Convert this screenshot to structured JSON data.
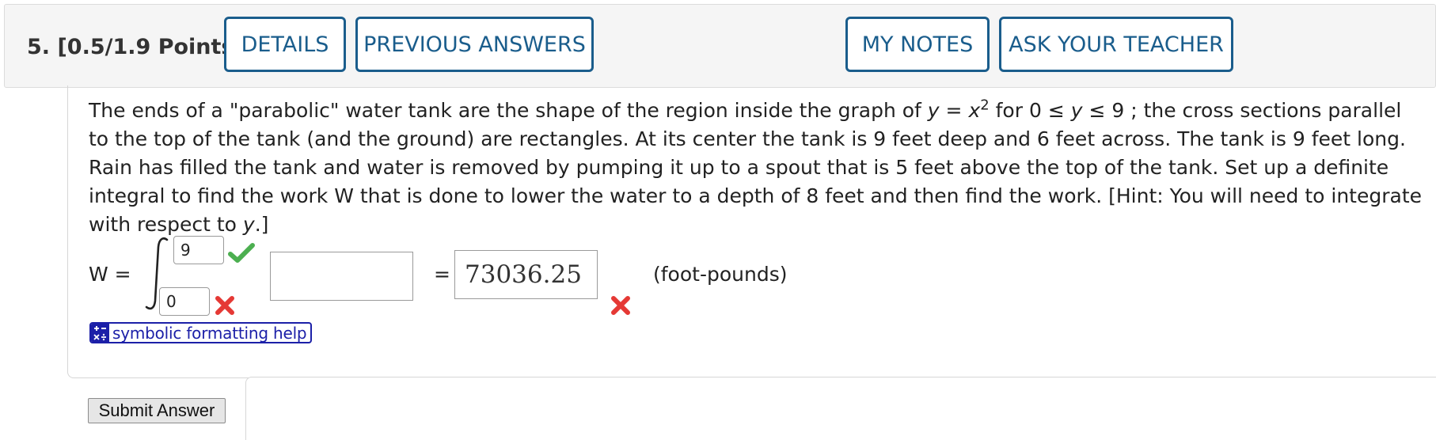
{
  "header": {
    "question_number": "5.",
    "points": "[0.5/1.9 Points]",
    "details_label": "DETAILS",
    "previous_answers_label": "PREVIOUS ANSWERS",
    "my_notes_label": "MY NOTES",
    "ask_teacher_label": "ASK YOUR TEACHER",
    "accent_color": "#1a5d8c"
  },
  "problem": {
    "part1": "The ends of a \"parabolic\" water tank are the shape of the region inside the graph of ",
    "math1_y": "y",
    "math1_eq": " = ",
    "math1_x": "x",
    "math1_exp": "2",
    "part2": " for ",
    "math2_a": "0 ≤ ",
    "math2_y": "y",
    "math2_b": " ≤ 9",
    "part3": " ; the cross sections parallel to the top of the tank (and the ground) are rectangles. At its center the tank is 9 feet deep and 6 feet across. The tank is 9 feet long. Rain has filled the tank and water is removed by pumping it up to a spout that is 5 feet above the top of the tank. Set up a definite integral to find the work W that is done to lower the water to a depth of 8 feet and then find the work. [Hint: You will need to integrate with respect to ",
    "hint_var": "y",
    "part4": ".]"
  },
  "answer_form": {
    "w_label": "W =",
    "upper_limit": "9",
    "lower_limit": "0",
    "integrand_value": "",
    "equals": "=",
    "answer_value": "73036.25",
    "units": "(foot-pounds)",
    "correct_color": "#4caf50",
    "incorrect_color": "#e53935"
  },
  "symbolic_help": {
    "label": "symbolic formatting help",
    "color": "#1c20a8"
  },
  "submit_label": "Submit Answer"
}
